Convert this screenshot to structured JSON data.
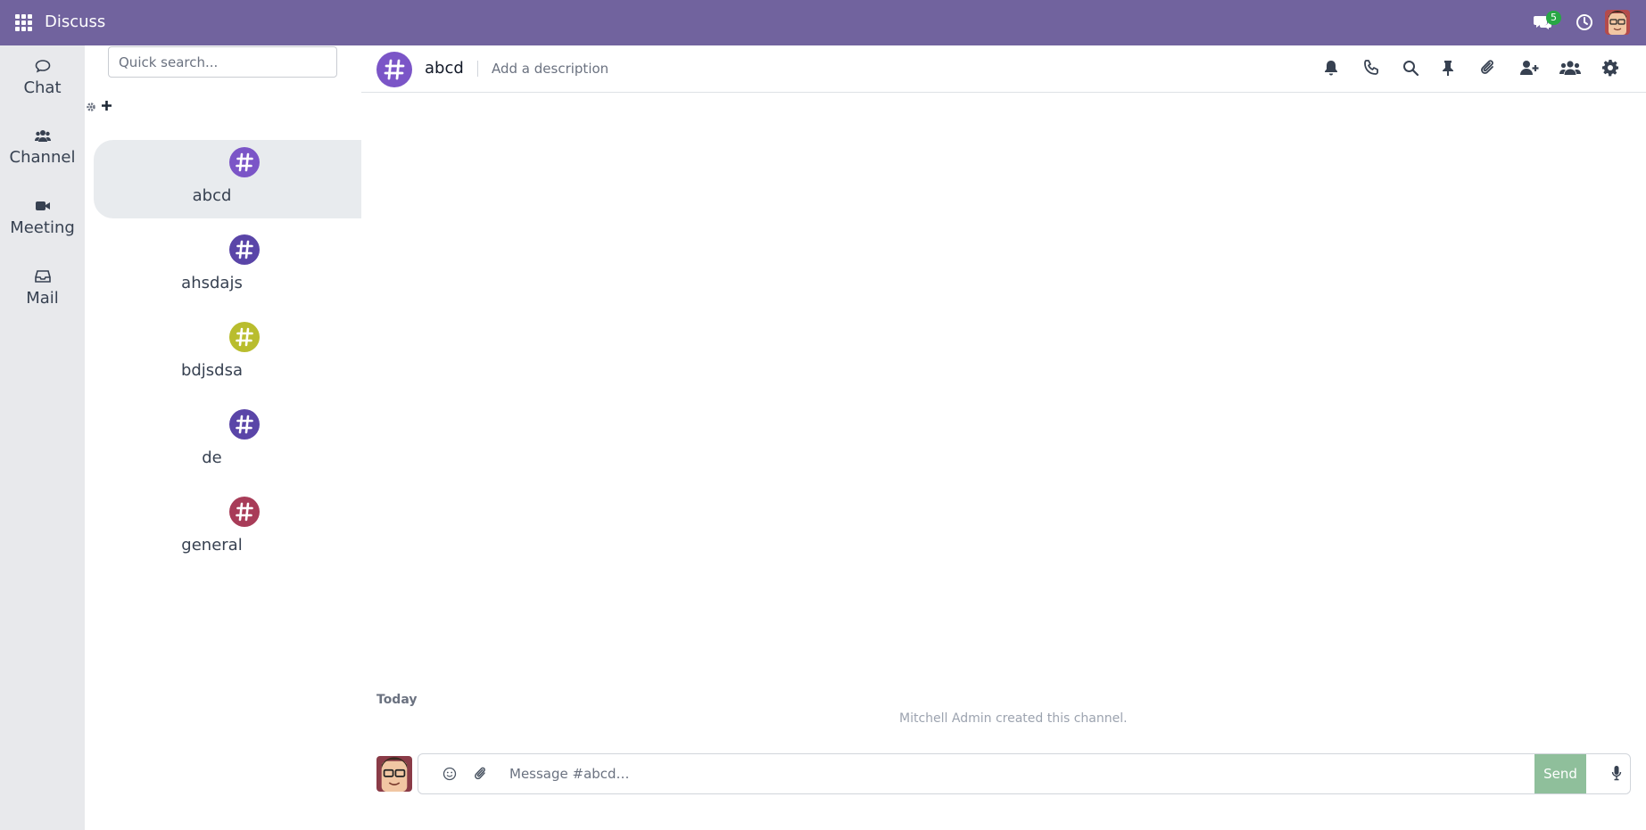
{
  "navbar": {
    "app_title": "Discuss",
    "messages_badge": "5",
    "bg_color": "#71639e"
  },
  "leftbar": {
    "items": [
      {
        "label": "Chat",
        "icon": "chat-icon"
      },
      {
        "label": "Channel",
        "icon": "users-icon"
      },
      {
        "label": "Meeting",
        "icon": "video-icon"
      },
      {
        "label": "Mail",
        "icon": "inbox-icon"
      }
    ]
  },
  "channels": {
    "search_placeholder": "Quick search...",
    "items": [
      {
        "name": "abcd",
        "color": "#7b55c7",
        "active": true
      },
      {
        "name": "ahsdajs",
        "color": "#5a45a8",
        "active": false
      },
      {
        "name": "bdjsdsa",
        "color": "#b9bd2e",
        "active": false
      },
      {
        "name": "de",
        "color": "#5a45a8",
        "active": false
      },
      {
        "name": "general",
        "color": "#a83c58",
        "active": false
      }
    ]
  },
  "thread": {
    "name": "abcd",
    "description_placeholder": "Add a description",
    "date_separator": "Today",
    "notification": "Mitchell Admin created this channel."
  },
  "composer": {
    "placeholder": "Message #abcd…",
    "send_label": "Send"
  }
}
